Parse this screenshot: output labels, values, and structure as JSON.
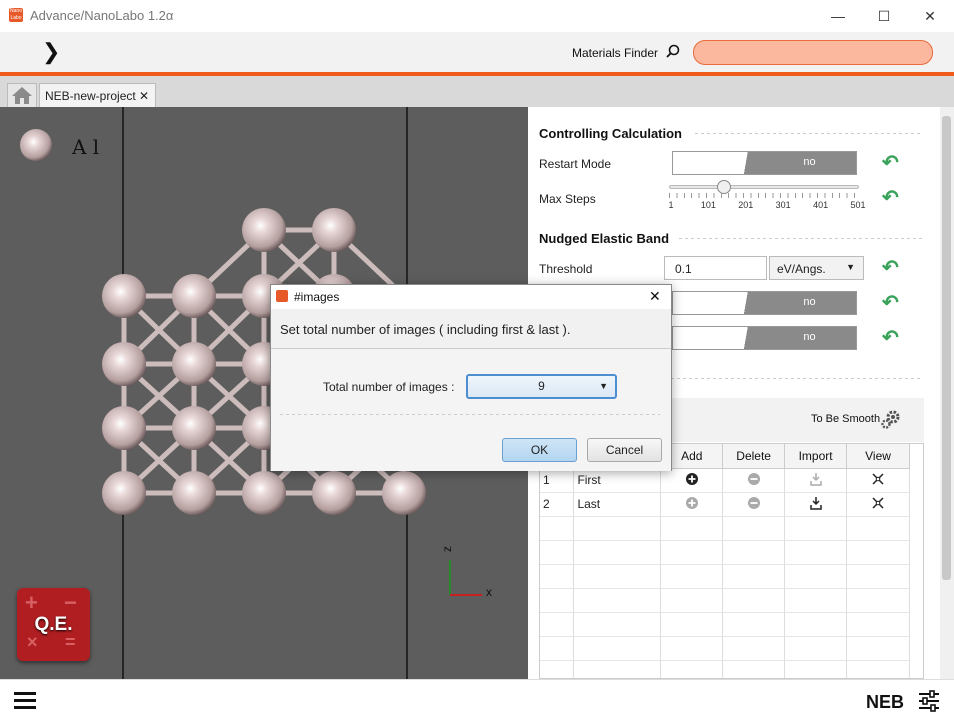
{
  "window": {
    "title": "Advance/NanoLabo 1.2α",
    "icon_text": "Nano Labo",
    "minimize": "—",
    "maximize": "☐",
    "close": "✕"
  },
  "toolbar": {
    "forward": "❯",
    "finder_label": "Materials Finder",
    "finder_value": ""
  },
  "tabs": [
    {
      "label": "NEB-new-project",
      "close": "✕"
    }
  ],
  "viewer": {
    "element_label": "A l",
    "axis_z": "z",
    "axis_x": "x",
    "qe_label": "Q.E."
  },
  "controlling": {
    "title": "Controlling Calculation",
    "restart_label": "Restart Mode",
    "restart_value": "no",
    "maxsteps_label": "Max Steps",
    "maxsteps_ticks": [
      "1",
      "101",
      "201",
      "301",
      "401",
      "501"
    ],
    "maxsteps_fraction": 0.27
  },
  "neb": {
    "title": "Nudged Elastic Band",
    "threshold_label": "Threshold",
    "threshold_value": "0.1",
    "threshold_unit": "eV/Angs.",
    "toggle2_value": "no",
    "toggle3_value": "no"
  },
  "images": {
    "smooth_label": "To Be Smooth",
    "columns": [
      "",
      "",
      "Add",
      "Delete",
      "Import",
      "View"
    ],
    "rows": [
      {
        "index": "1",
        "name": "First"
      },
      {
        "index": "2",
        "name": "Last"
      }
    ]
  },
  "bottom": {
    "mode": "NEB"
  },
  "dialog": {
    "title": "#images",
    "message": "Set total number of images ( including first & last ).",
    "field_label": "Total number of images :",
    "field_value": "9",
    "ok": "OK",
    "cancel": "Cancel",
    "close": "✕"
  },
  "colors": {
    "accent": "#f05a1a",
    "finder_fill": "#fbb89e",
    "undo": "#3aa25a",
    "qe_red": "#b01e22"
  }
}
